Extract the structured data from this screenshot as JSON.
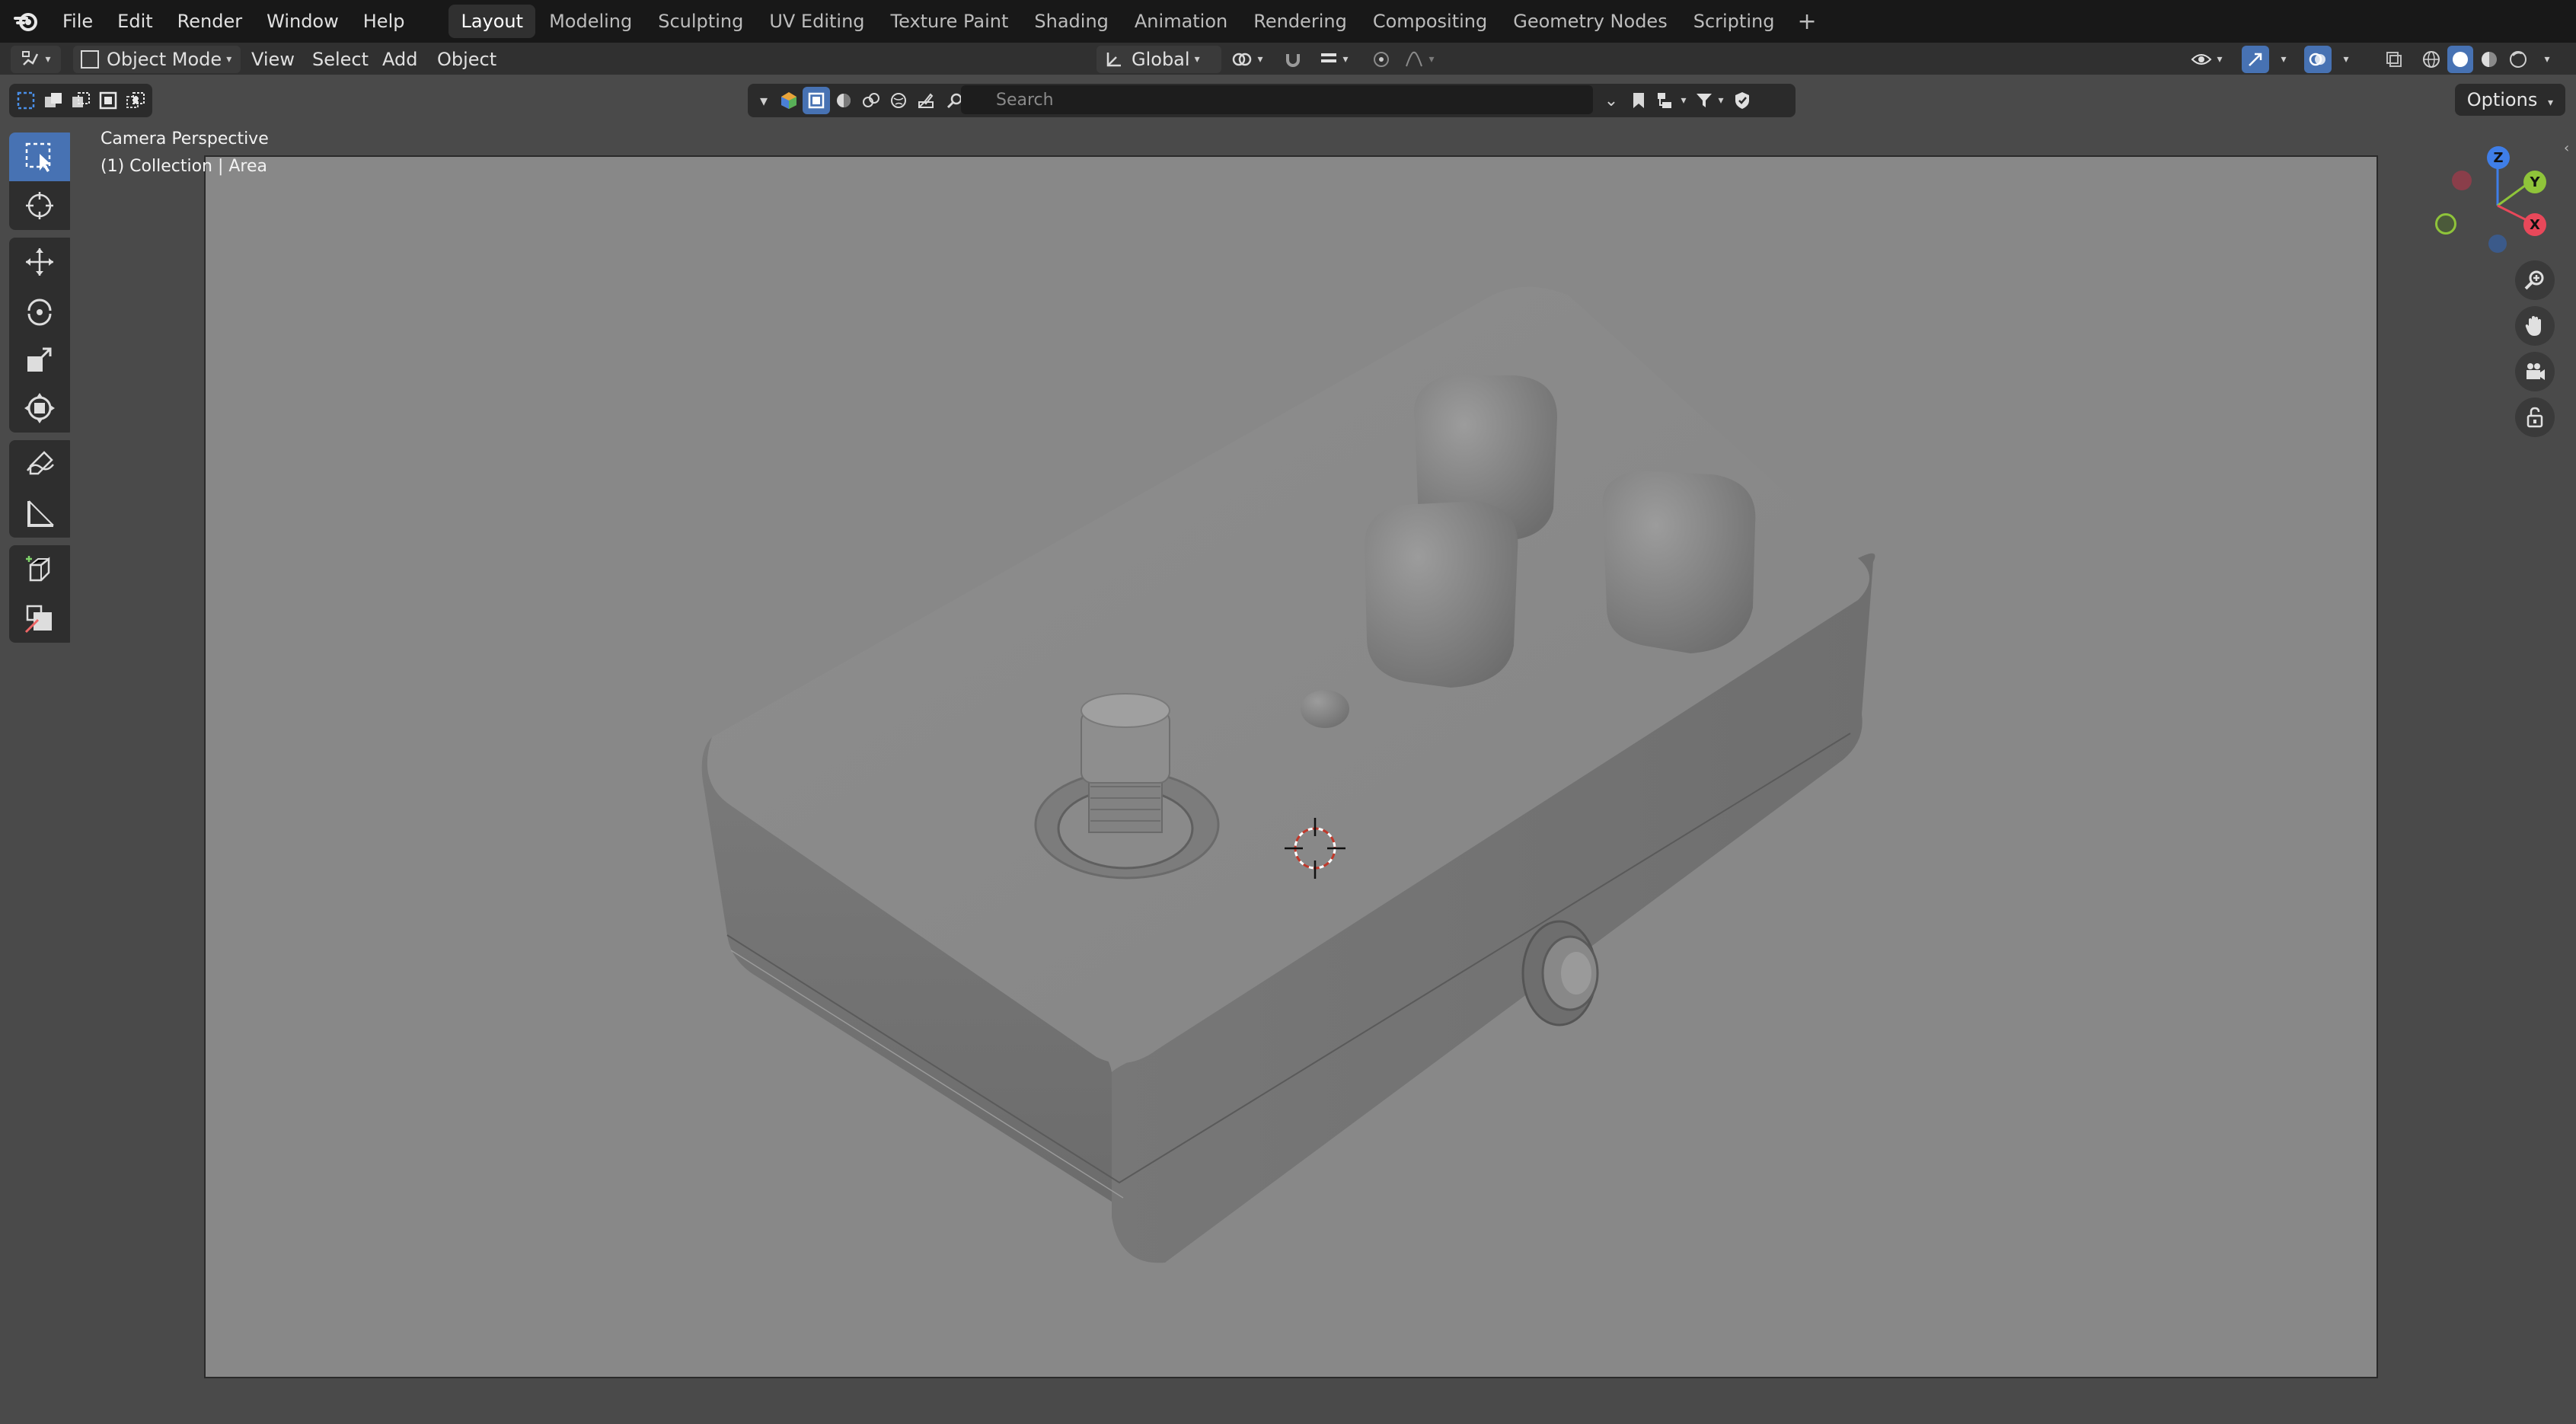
{
  "menus": [
    "File",
    "Edit",
    "Render",
    "Window",
    "Help"
  ],
  "workspaces": [
    {
      "label": "Layout",
      "active": true
    },
    {
      "label": "Modeling",
      "active": false
    },
    {
      "label": "Sculpting",
      "active": false
    },
    {
      "label": "UV Editing",
      "active": false
    },
    {
      "label": "Texture Paint",
      "active": false
    },
    {
      "label": "Shading",
      "active": false
    },
    {
      "label": "Animation",
      "active": false
    },
    {
      "label": "Rendering",
      "active": false
    },
    {
      "label": "Compositing",
      "active": false
    },
    {
      "label": "Geometry Nodes",
      "active": false
    },
    {
      "label": "Scripting",
      "active": false
    }
  ],
  "header": {
    "mode": "Object Mode",
    "view": "View",
    "select": "Select",
    "add": "Add",
    "object": "Object",
    "orientation": "Global"
  },
  "search": {
    "placeholder": "Search"
  },
  "options_label": "Options",
  "viewport": {
    "camera_label": "Camera Perspective",
    "collection_label": "(1) Collection | Area"
  },
  "gizmo": {
    "z": "Z",
    "y": "Y",
    "x": "X"
  },
  "colors": {
    "accent": "#4772b3",
    "axis_x": "#e8485a",
    "axis_y": "#8fc43a",
    "axis_z": "#3f7ee8",
    "model_gray": "#8a8a8a"
  },
  "icons": [
    "blender-logo-icon",
    "select-box-icon",
    "cursor-icon",
    "move-icon",
    "rotate-icon",
    "scale-icon",
    "transform-icon",
    "annotate-icon",
    "measure-icon",
    "add-cube-icon",
    "knife-icon",
    "zoom-icon",
    "hand-icon",
    "camera-icon",
    "lock-icon"
  ]
}
